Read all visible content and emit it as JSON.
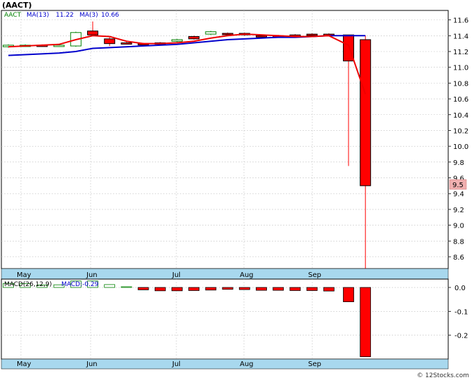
{
  "title": "(AACT)",
  "watermark": "© 12Stocks.com",
  "price_legend": {
    "symbol": "AACT",
    "ma_long_label": "MA(13)",
    "ma_long_value": "11.22",
    "ma_short_label": "MA(3)",
    "ma_short_value": "10.66"
  },
  "macd_legend": {
    "label": "MACD(26,12,9)",
    "value_label": "MACD:-0.29"
  },
  "last_price_label": "9.5",
  "colors": {
    "up_candle": "#008000",
    "down_candle": "#ff0000",
    "ma_long": "#0000cc",
    "ma_short": "#ee0000",
    "grid": "#c8c8c8",
    "axis_band": "#a8d8ee",
    "last_price_bg": "#f0b0b0"
  },
  "chart_data": [
    {
      "type": "candlestick",
      "title": "(AACT)",
      "x_tick_labels": [
        "May",
        "Jun",
        "Jul",
        "Aug",
        "Sep"
      ],
      "y_tick_labels": [
        "11.6",
        "11.4",
        "11.2",
        "11.0",
        "10.8",
        "10.6",
        "10.4",
        "10.2",
        "10.0",
        "9.8",
        "9.6",
        "9.4",
        "9.2",
        "9.0",
        "8.8",
        "8.6"
      ],
      "ylim": [
        8.45,
        11.72
      ],
      "grid": true,
      "candles": [
        {
          "open": 11.26,
          "close": 11.28,
          "high": 11.29,
          "low": 11.25,
          "dir": "up"
        },
        {
          "open": 11.27,
          "close": 11.28,
          "high": 11.29,
          "low": 11.26,
          "dir": "up"
        },
        {
          "open": 11.28,
          "close": 11.27,
          "high": 11.29,
          "low": 11.26,
          "dir": "down"
        },
        {
          "open": 11.27,
          "close": 11.28,
          "high": 11.29,
          "low": 11.26,
          "dir": "up"
        },
        {
          "open": 11.27,
          "close": 11.44,
          "high": 11.45,
          "low": 11.26,
          "dir": "up"
        },
        {
          "open": 11.46,
          "close": 11.41,
          "high": 11.58,
          "low": 11.4,
          "dir": "down"
        },
        {
          "open": 11.36,
          "close": 11.3,
          "high": 11.38,
          "low": 11.27,
          "dir": "down"
        },
        {
          "open": 11.31,
          "close": 11.3,
          "high": 11.32,
          "low": 11.29,
          "dir": "down"
        },
        {
          "open": 11.3,
          "close": 11.29,
          "high": 11.31,
          "low": 11.29,
          "dir": "down"
        },
        {
          "open": 11.31,
          "close": 11.3,
          "high": 11.32,
          "low": 11.29,
          "dir": "down"
        },
        {
          "open": 11.33,
          "close": 11.35,
          "high": 11.36,
          "low": 11.32,
          "dir": "up"
        },
        {
          "open": 11.39,
          "close": 11.36,
          "high": 11.4,
          "low": 11.35,
          "dir": "down"
        },
        {
          "open": 11.42,
          "close": 11.45,
          "high": 11.46,
          "low": 11.41,
          "dir": "up"
        },
        {
          "open": 11.43,
          "close": 11.42,
          "high": 11.44,
          "low": 11.41,
          "dir": "down"
        },
        {
          "open": 11.43,
          "close": 11.41,
          "high": 11.44,
          "low": 11.4,
          "dir": "down"
        },
        {
          "open": 11.4,
          "close": 11.39,
          "high": 11.41,
          "low": 11.38,
          "dir": "down"
        },
        {
          "open": 11.4,
          "close": 11.4,
          "high": 11.41,
          "low": 11.39,
          "dir": "down"
        },
        {
          "open": 11.41,
          "close": 11.4,
          "high": 11.42,
          "low": 11.4,
          "dir": "down"
        },
        {
          "open": 11.42,
          "close": 11.41,
          "high": 11.43,
          "low": 11.41,
          "dir": "down"
        },
        {
          "open": 11.42,
          "close": 11.41,
          "high": 11.43,
          "low": 11.4,
          "dir": "down"
        },
        {
          "open": 11.41,
          "close": 11.08,
          "high": 11.41,
          "low": 9.75,
          "dir": "down"
        },
        {
          "open": 11.35,
          "close": 9.5,
          "high": 11.4,
          "low": 8.45,
          "dir": "down"
        }
      ],
      "series": [
        {
          "name": "MA(13)",
          "values": [
            11.15,
            11.16,
            11.17,
            11.18,
            11.2,
            11.24,
            11.25,
            11.26,
            11.27,
            11.28,
            11.29,
            11.31,
            11.33,
            11.35,
            11.36,
            11.37,
            11.38,
            11.38,
            11.39,
            11.4,
            11.4,
            11.4
          ]
        },
        {
          "name": "MA(3)",
          "values": [
            11.26,
            11.27,
            11.28,
            11.29,
            11.35,
            11.4,
            11.39,
            11.33,
            11.3,
            11.3,
            11.31,
            11.33,
            11.37,
            11.4,
            11.42,
            11.41,
            11.4,
            11.39,
            11.39,
            11.4,
            11.28,
            10.66
          ]
        }
      ]
    },
    {
      "type": "bar",
      "title": "MACD(26,12,9)",
      "x_tick_labels": [
        "May",
        "Jun",
        "Jul",
        "Aug",
        "Sep"
      ],
      "y_tick_labels": [
        "0.0",
        "-0.1",
        "-0.2"
      ],
      "ylim": [
        -0.3,
        0.035
      ],
      "values": [
        0.017,
        0.016,
        0.01,
        0.011,
        0.027,
        0.027,
        0.012,
        0.003,
        -0.01,
        -0.014,
        -0.014,
        -0.013,
        -0.011,
        -0.008,
        -0.009,
        -0.012,
        -0.012,
        -0.013,
        -0.013,
        -0.015,
        -0.06,
        -0.29
      ]
    }
  ]
}
